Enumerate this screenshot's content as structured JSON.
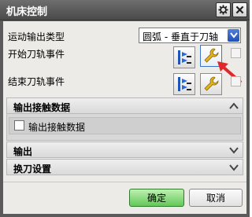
{
  "window": {
    "title": "机床控制"
  },
  "form": {
    "motion_output_label": "运动输出类型",
    "motion_output_value": "圆弧 - 垂直于刀轴",
    "start_events_label": "开始刀轨事件",
    "end_events_label": "结束刀轨事件"
  },
  "sections": {
    "contact_data": {
      "title": "输出接触数据",
      "checkbox_label": "输出接触数据",
      "checked": false
    },
    "output": {
      "title": "输出"
    },
    "tool_change": {
      "title": "换刀设置"
    }
  },
  "buttons": {
    "ok": "确定",
    "cancel": "取消"
  },
  "icons": {
    "gear": "gear-icon",
    "close": "close-icon",
    "dropdown": "chevron-down-icon",
    "event_list": "event-list-icon",
    "user_defined": "wrench-icon",
    "collapse": "chevron-up-icon",
    "expand": "chevron-down-icon"
  },
  "colors": {
    "titlebar": "#5b5b5b",
    "ok_button": "#6fcf62",
    "accent_blue": "#2f5fc4",
    "annotation_arrow": "#e0282a"
  }
}
